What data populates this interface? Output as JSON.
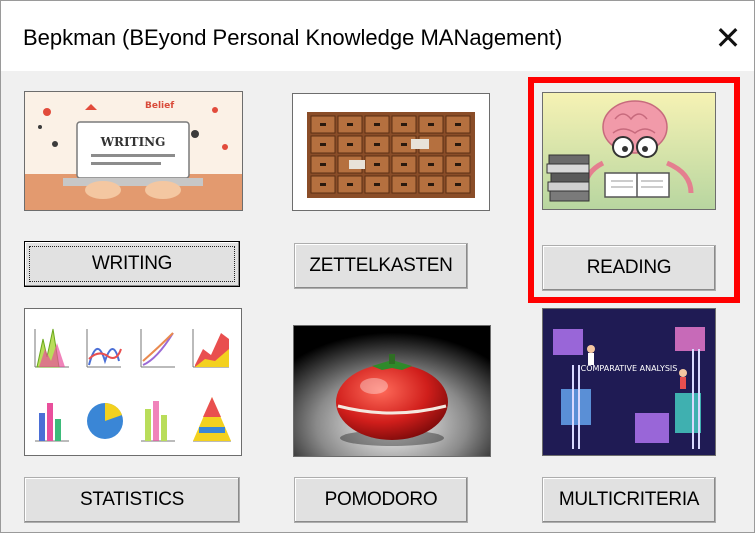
{
  "window": {
    "title": "Bepkman (BEyond Personal Knowledge MANagement)",
    "close_symbol": "✕"
  },
  "tiles": {
    "writing": {
      "label": "WRITING",
      "image_text": "WRITING",
      "image_tag": "Belief"
    },
    "zettelkasten": {
      "label": "ZETTELKASTEN"
    },
    "reading": {
      "label": "READING"
    },
    "statistics": {
      "label": "STATISTICS"
    },
    "pomodoro": {
      "label": "POMODORO"
    },
    "multicriteria": {
      "label": "MULTICRITERIA",
      "image_text": "COMPARATIVE ANALYSIS"
    }
  },
  "colors": {
    "highlight": "#ff0000",
    "button_face": "#e1e1e1",
    "window_bg": "#f0f0f0"
  },
  "icons": [
    "close-icon"
  ]
}
